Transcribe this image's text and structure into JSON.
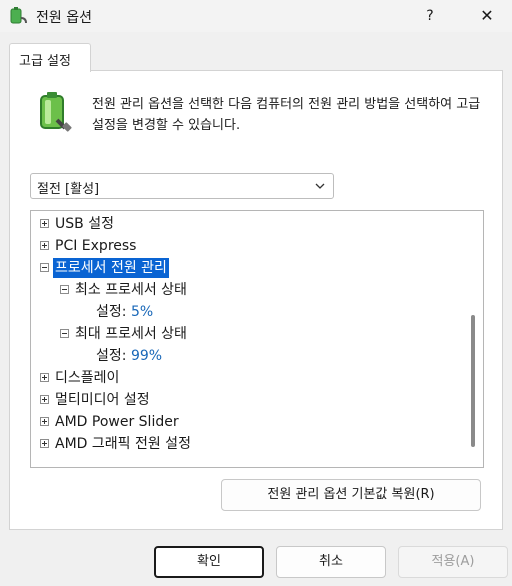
{
  "window": {
    "title": "전원 옵션",
    "help_label": "?",
    "close_label": "✕"
  },
  "tab": {
    "label": "고급 설정"
  },
  "description": "전원 관리 옵션을 선택한 다음 컴퓨터의 전원 관리 방법을 선택하여 고급 설정을 변경할 수 있습니다.",
  "scheme_select": {
    "value": "절전 [활성]"
  },
  "tree": {
    "items": [
      {
        "label": "USB 설정",
        "expanded": false
      },
      {
        "label": "PCI Express",
        "expanded": false
      },
      {
        "label": "프로세서 전원 관리",
        "expanded": true,
        "selected": true
      },
      {
        "label": "최소 프로세서 상태",
        "expanded": true
      },
      {
        "setting_label": "설정:",
        "setting_value": "5%"
      },
      {
        "label": "최대 프로세서 상태",
        "expanded": true
      },
      {
        "setting_label": "설정:",
        "setting_value": "99%"
      },
      {
        "label": "디스플레이",
        "expanded": false
      },
      {
        "label": "멀티미디어 설정",
        "expanded": false
      },
      {
        "label": "AMD Power Slider",
        "expanded": false
      },
      {
        "label": "AMD 그래픽 전원 설정",
        "expanded": false
      }
    ]
  },
  "buttons": {
    "restore": "전원 관리 옵션 기본값 복원(R)",
    "ok": "확인",
    "cancel": "취소",
    "apply": "적용(A)"
  },
  "colors": {
    "selection": "#0a64d3",
    "setting_value": "#1867b8"
  }
}
